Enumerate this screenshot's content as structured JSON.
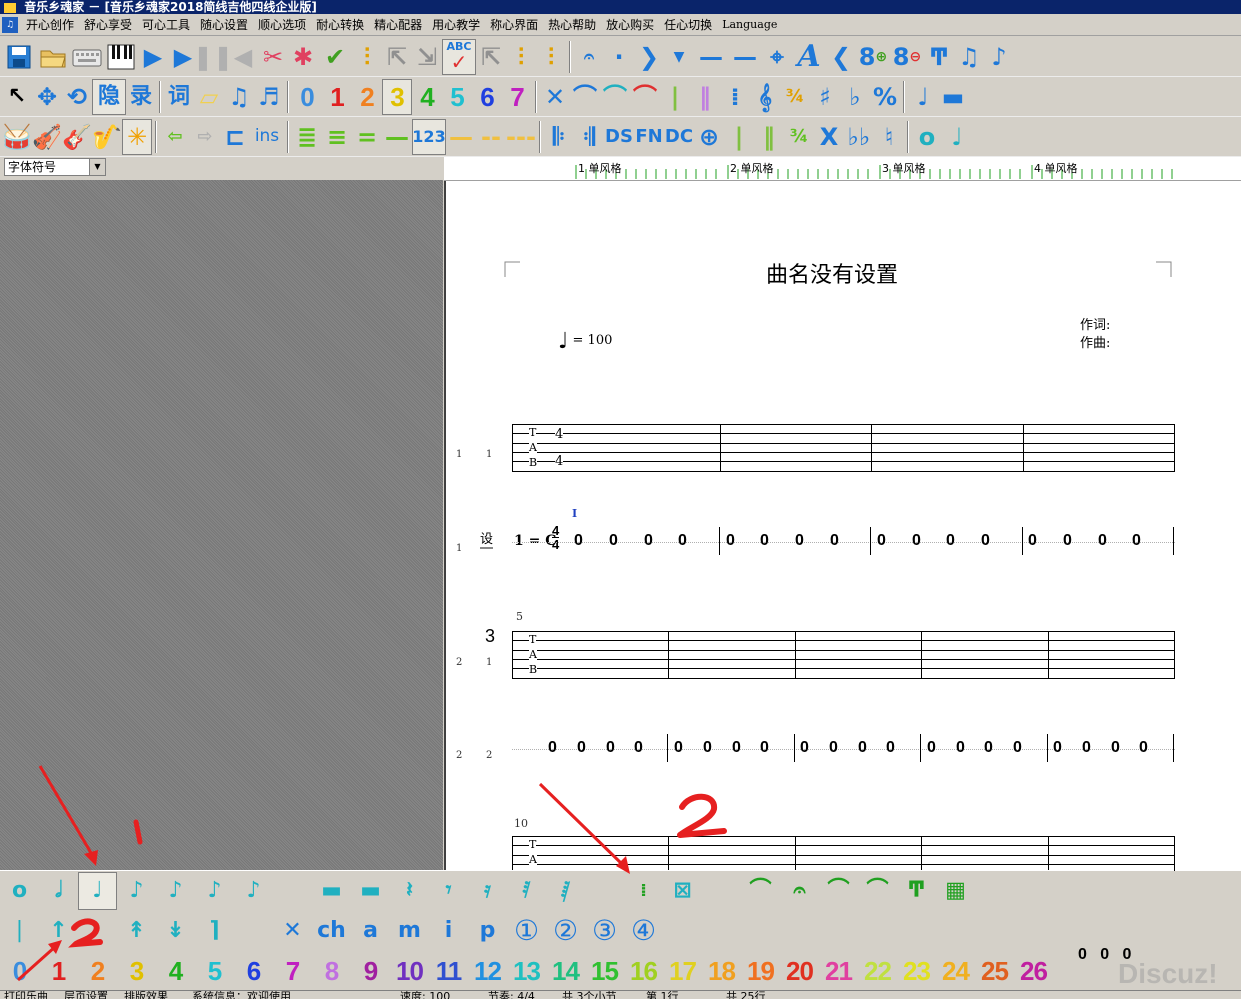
{
  "window": {
    "title": "音乐乡魂家 － [音乐乡魂家2018简线吉他四线企业版]"
  },
  "menu": {
    "items": [
      "开心创作",
      "舒心享受",
      "可心工具",
      "随心设置",
      "顺心选项",
      "耐心转换",
      "精心配器",
      "用心教学",
      "称心界面",
      "热心帮助",
      "放心购买",
      "任心切换",
      "Language"
    ]
  },
  "toolbar2": {
    "hidden_label": "隐",
    "record_label": "录",
    "lyrics_label": "词"
  },
  "toolbar3": {
    "ins_label": "ins",
    "num_label": "123",
    "ds_label": "DS",
    "fn_label": "FN",
    "dc_label": "DC"
  },
  "font_selector": {
    "value": "字体符号"
  },
  "ruler": {
    "labels": [
      "1 单风格",
      "2 单风格",
      "3 单风格",
      "4 单风格"
    ]
  },
  "score": {
    "title": "曲名没有设置",
    "lyricist_label": "作词:",
    "composer_label": "作曲:",
    "tempo_note": "♩",
    "tempo_value": "= 100",
    "tab_letters": [
      "T",
      "A",
      "B"
    ],
    "time_sig_top": "4",
    "time_sig_bottom": "4",
    "key_label": "1 = C",
    "set_button": "设",
    "roman_marker": "I",
    "measure_numbers": [
      "5",
      "10"
    ],
    "row_labels": {
      "row1_tab": [
        "1",
        "1"
      ],
      "row1_jianpu": "1",
      "row2_tab": [
        "2",
        "1"
      ],
      "row2_jianpu": [
        "2",
        "2"
      ],
      "row3_tab": [
        "3",
        "1"
      ]
    },
    "big_mark": "3",
    "rest_symbol": "0",
    "overflow_rests": [
      "0",
      "0",
      "0"
    ]
  },
  "palette": {
    "articulation_labels": [
      "ch",
      "a",
      "m",
      "i",
      "p"
    ],
    "circled_numbers": [
      "①",
      "②",
      "③",
      "④"
    ],
    "numbers": [
      "0",
      "1",
      "2",
      "3",
      "4",
      "5",
      "6",
      "7",
      "8",
      "9",
      "10",
      "11",
      "12",
      "13",
      "14",
      "15",
      "16",
      "17",
      "18",
      "19",
      "20",
      "21",
      "22",
      "23",
      "24",
      "25",
      "26"
    ],
    "number_colors": [
      "#3a8dde",
      "#e02020",
      "#f08020",
      "#e0c000",
      "#20b020",
      "#20c0d0",
      "#2040e0",
      "#c020c0",
      "#c070e0",
      "#a020a0",
      "#7030c0",
      "#3050d0",
      "#2090e0",
      "#20c0c0",
      "#20c080",
      "#30c030",
      "#a0d020",
      "#e0d020",
      "#f0a020",
      "#f07020",
      "#e03020",
      "#e040a0",
      "#c0e040",
      "#e0e020",
      "#f0b020",
      "#e06020",
      "#c020a0"
    ]
  },
  "statusbar": {
    "items": [
      "打印乐曲",
      "层页设置",
      "排版效果",
      "系统信息：欢迎使用",
      "速度: 100",
      "节奏: 4/4",
      "共 3个小节",
      "第 1行",
      "共 25行"
    ]
  },
  "watermark": "Discuz!",
  "colors": {
    "title_bar": "#0a246a",
    "accent_blue": "#1e78d8",
    "annotation_red": "#e62020"
  }
}
